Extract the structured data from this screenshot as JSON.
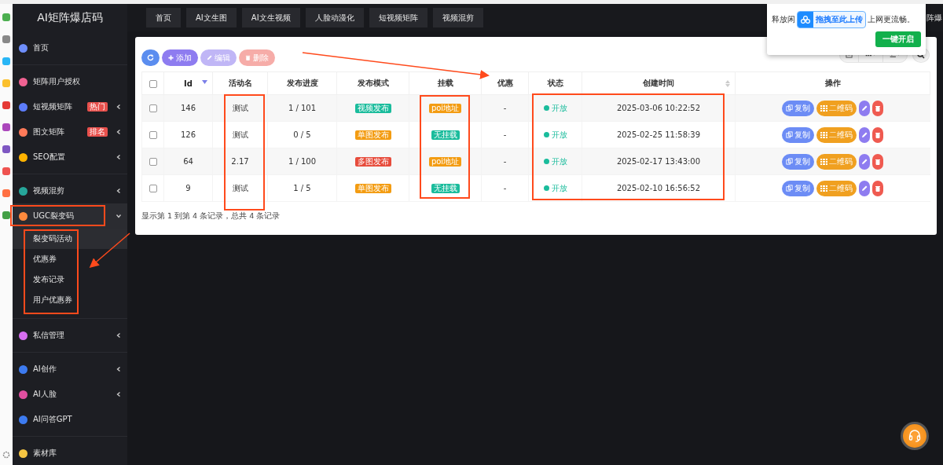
{
  "sidebar": {
    "logo": "AI矩阵爆店码",
    "groups": [
      [
        {
          "label": "首页",
          "expandable": false,
          "expanded": false,
          "selected": false
        }
      ],
      [
        {
          "label": "矩阵用户授权",
          "expandable": false,
          "expanded": false,
          "selected": false
        },
        {
          "label": "短视频矩阵",
          "badge": "热门",
          "expandable": true,
          "expanded": false,
          "selected": false
        },
        {
          "label": "图文矩阵",
          "badge": "排名",
          "expandable": true,
          "expanded": false,
          "selected": false
        },
        {
          "label": "SEO配置",
          "expandable": true,
          "expanded": false,
          "selected": false
        }
      ],
      [
        {
          "label": "视频混剪",
          "expandable": true,
          "expanded": false,
          "selected": false
        },
        {
          "label": "UGC裂变码",
          "expandable": true,
          "expanded": true,
          "selected": false,
          "children": [
            {
              "label": "裂变码活动",
              "selected": true
            },
            {
              "label": "优惠券",
              "selected": false
            },
            {
              "label": "发布记录",
              "selected": false
            },
            {
              "label": "用户优惠券",
              "selected": false
            }
          ]
        }
      ],
      [
        {
          "label": "私信管理",
          "expandable": true,
          "expanded": false,
          "selected": false
        }
      ],
      [
        {
          "label": "AI创作",
          "expandable": true,
          "expanded": false,
          "selected": false
        },
        {
          "label": "AI人脸",
          "expandable": true,
          "expanded": false,
          "selected": false
        },
        {
          "label": "AI问答GPT",
          "expandable": false,
          "expanded": false,
          "selected": false
        }
      ],
      [
        {
          "label": "素材库",
          "expandable": false,
          "expanded": false,
          "selected": false
        }
      ]
    ]
  },
  "header": {
    "tabs": [
      "首页",
      "AI文生图",
      "AI文生视频",
      "人脸动漫化",
      "短视频矩阵",
      "视频混剪"
    ],
    "user_text": "阵爆"
  },
  "popup": {
    "text_before": "释放闲",
    "text_after": "上网更流畅。",
    "upload_badge": "拖拽至此上传",
    "button": "一键开启"
  },
  "toolbar": {
    "buttons": [
      {
        "kind": "refresh",
        "disabled": false
      },
      {
        "kind": "add",
        "label": "添加",
        "disabled": false
      },
      {
        "kind": "edit",
        "label": "编辑",
        "disabled": true
      },
      {
        "kind": "delete",
        "label": "删除",
        "disabled": true
      }
    ]
  },
  "table": {
    "header_checked": false,
    "columns": [
      {
        "label": "Id",
        "sortable": true,
        "sorted": true
      },
      {
        "label": "活动名",
        "sortable": false,
        "sorted": false
      },
      {
        "label": "发布进度",
        "sortable": false,
        "sorted": false
      },
      {
        "label": "发布模式",
        "sortable": false,
        "sorted": false
      },
      {
        "label": "挂载",
        "sortable": false,
        "sorted": false
      },
      {
        "label": "优惠",
        "sortable": false,
        "sorted": false
      },
      {
        "label": "状态",
        "sortable": false,
        "sorted": false
      },
      {
        "label": "创建时间",
        "sortable": true,
        "sorted": false
      },
      {
        "label": "操作",
        "sortable": false,
        "sorted": false
      }
    ],
    "rows": [
      {
        "checked": false,
        "id": "146",
        "name": "测试",
        "progress": "1 / 101",
        "mode": {
          "text": "视频发布",
          "color": "#1abc9c"
        },
        "mount": {
          "text": "poi地址",
          "color": "#f39c12"
        },
        "discount": "-",
        "status": {
          "text": "开放",
          "color": "#1abc9c"
        },
        "created": "2025-03-06 10:22:52",
        "actions": [
          {
            "kind": "copy",
            "label": "复制"
          },
          {
            "kind": "qrcode",
            "label": "二维码"
          },
          {
            "kind": "edit"
          },
          {
            "kind": "delete"
          }
        ]
      },
      {
        "checked": false,
        "id": "126",
        "name": "测试",
        "progress": "0 / 5",
        "mode": {
          "text": "单图发布",
          "color": "#f39c12"
        },
        "mount": {
          "text": "无挂载",
          "color": "#1abc9c"
        },
        "discount": "-",
        "status": {
          "text": "开放",
          "color": "#1abc9c"
        },
        "created": "2025-02-25 11:58:39",
        "actions": [
          {
            "kind": "copy",
            "label": "复制"
          },
          {
            "kind": "qrcode",
            "label": "二维码"
          },
          {
            "kind": "edit"
          },
          {
            "kind": "delete"
          }
        ]
      },
      {
        "checked": false,
        "id": "64",
        "name": "2.17",
        "progress": "1 / 100",
        "mode": {
          "text": "多图发布",
          "color": "#e74c3c"
        },
        "mount": {
          "text": "poi地址",
          "color": "#f39c12"
        },
        "discount": "-",
        "status": {
          "text": "开放",
          "color": "#1abc9c"
        },
        "created": "2025-02-17 13:43:00",
        "actions": [
          {
            "kind": "copy",
            "label": "复制"
          },
          {
            "kind": "qrcode",
            "label": "二维码"
          },
          {
            "kind": "edit"
          },
          {
            "kind": "delete"
          }
        ]
      },
      {
        "checked": false,
        "id": "9",
        "name": "测试",
        "progress": "1 / 5",
        "mode": {
          "text": "单图发布",
          "color": "#f39c12"
        },
        "mount": {
          "text": "无挂载",
          "color": "#1abc9c"
        },
        "discount": "-",
        "status": {
          "text": "开放",
          "color": "#1abc9c"
        },
        "created": "2025-02-10 16:56:52",
        "actions": [
          {
            "kind": "copy",
            "label": "复制"
          },
          {
            "kind": "qrcode",
            "label": "二维码"
          },
          {
            "kind": "edit"
          },
          {
            "kind": "delete"
          }
        ]
      }
    ]
  },
  "footer": "显示第 1 到第 4 条记录，总共 4 条记录"
}
